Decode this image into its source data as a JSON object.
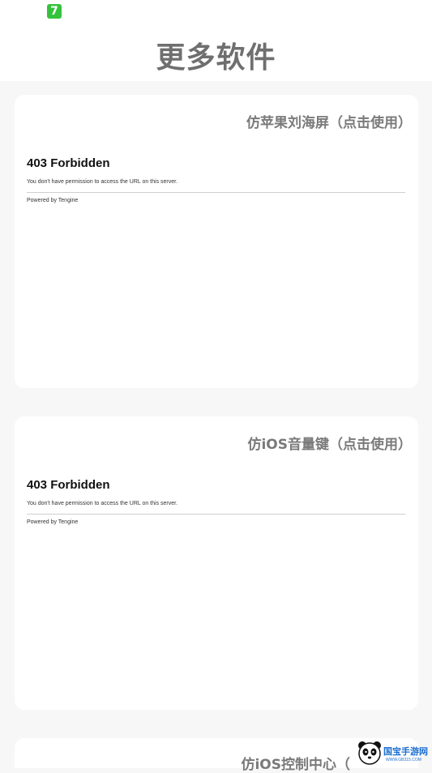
{
  "status_bar": {
    "app_badge": "7"
  },
  "header": {
    "title": "更多软件"
  },
  "cards": [
    {
      "title": "仿苹果刘海屏（点击使用）",
      "error_heading": "403 Forbidden",
      "error_message": "You don't have permission to access the URL on this server.",
      "powered_by": "Powered by Tengine"
    },
    {
      "title": "仿iOS音量键（点击使用）",
      "error_heading": "403 Forbidden",
      "error_message": "You don't have permission to access the URL on this server.",
      "powered_by": "Powered by Tengine"
    },
    {
      "title": "仿iOS控制中心（"
    }
  ],
  "watermark": {
    "text": "国宝手游网",
    "url": "WWW.GB315.COM"
  }
}
